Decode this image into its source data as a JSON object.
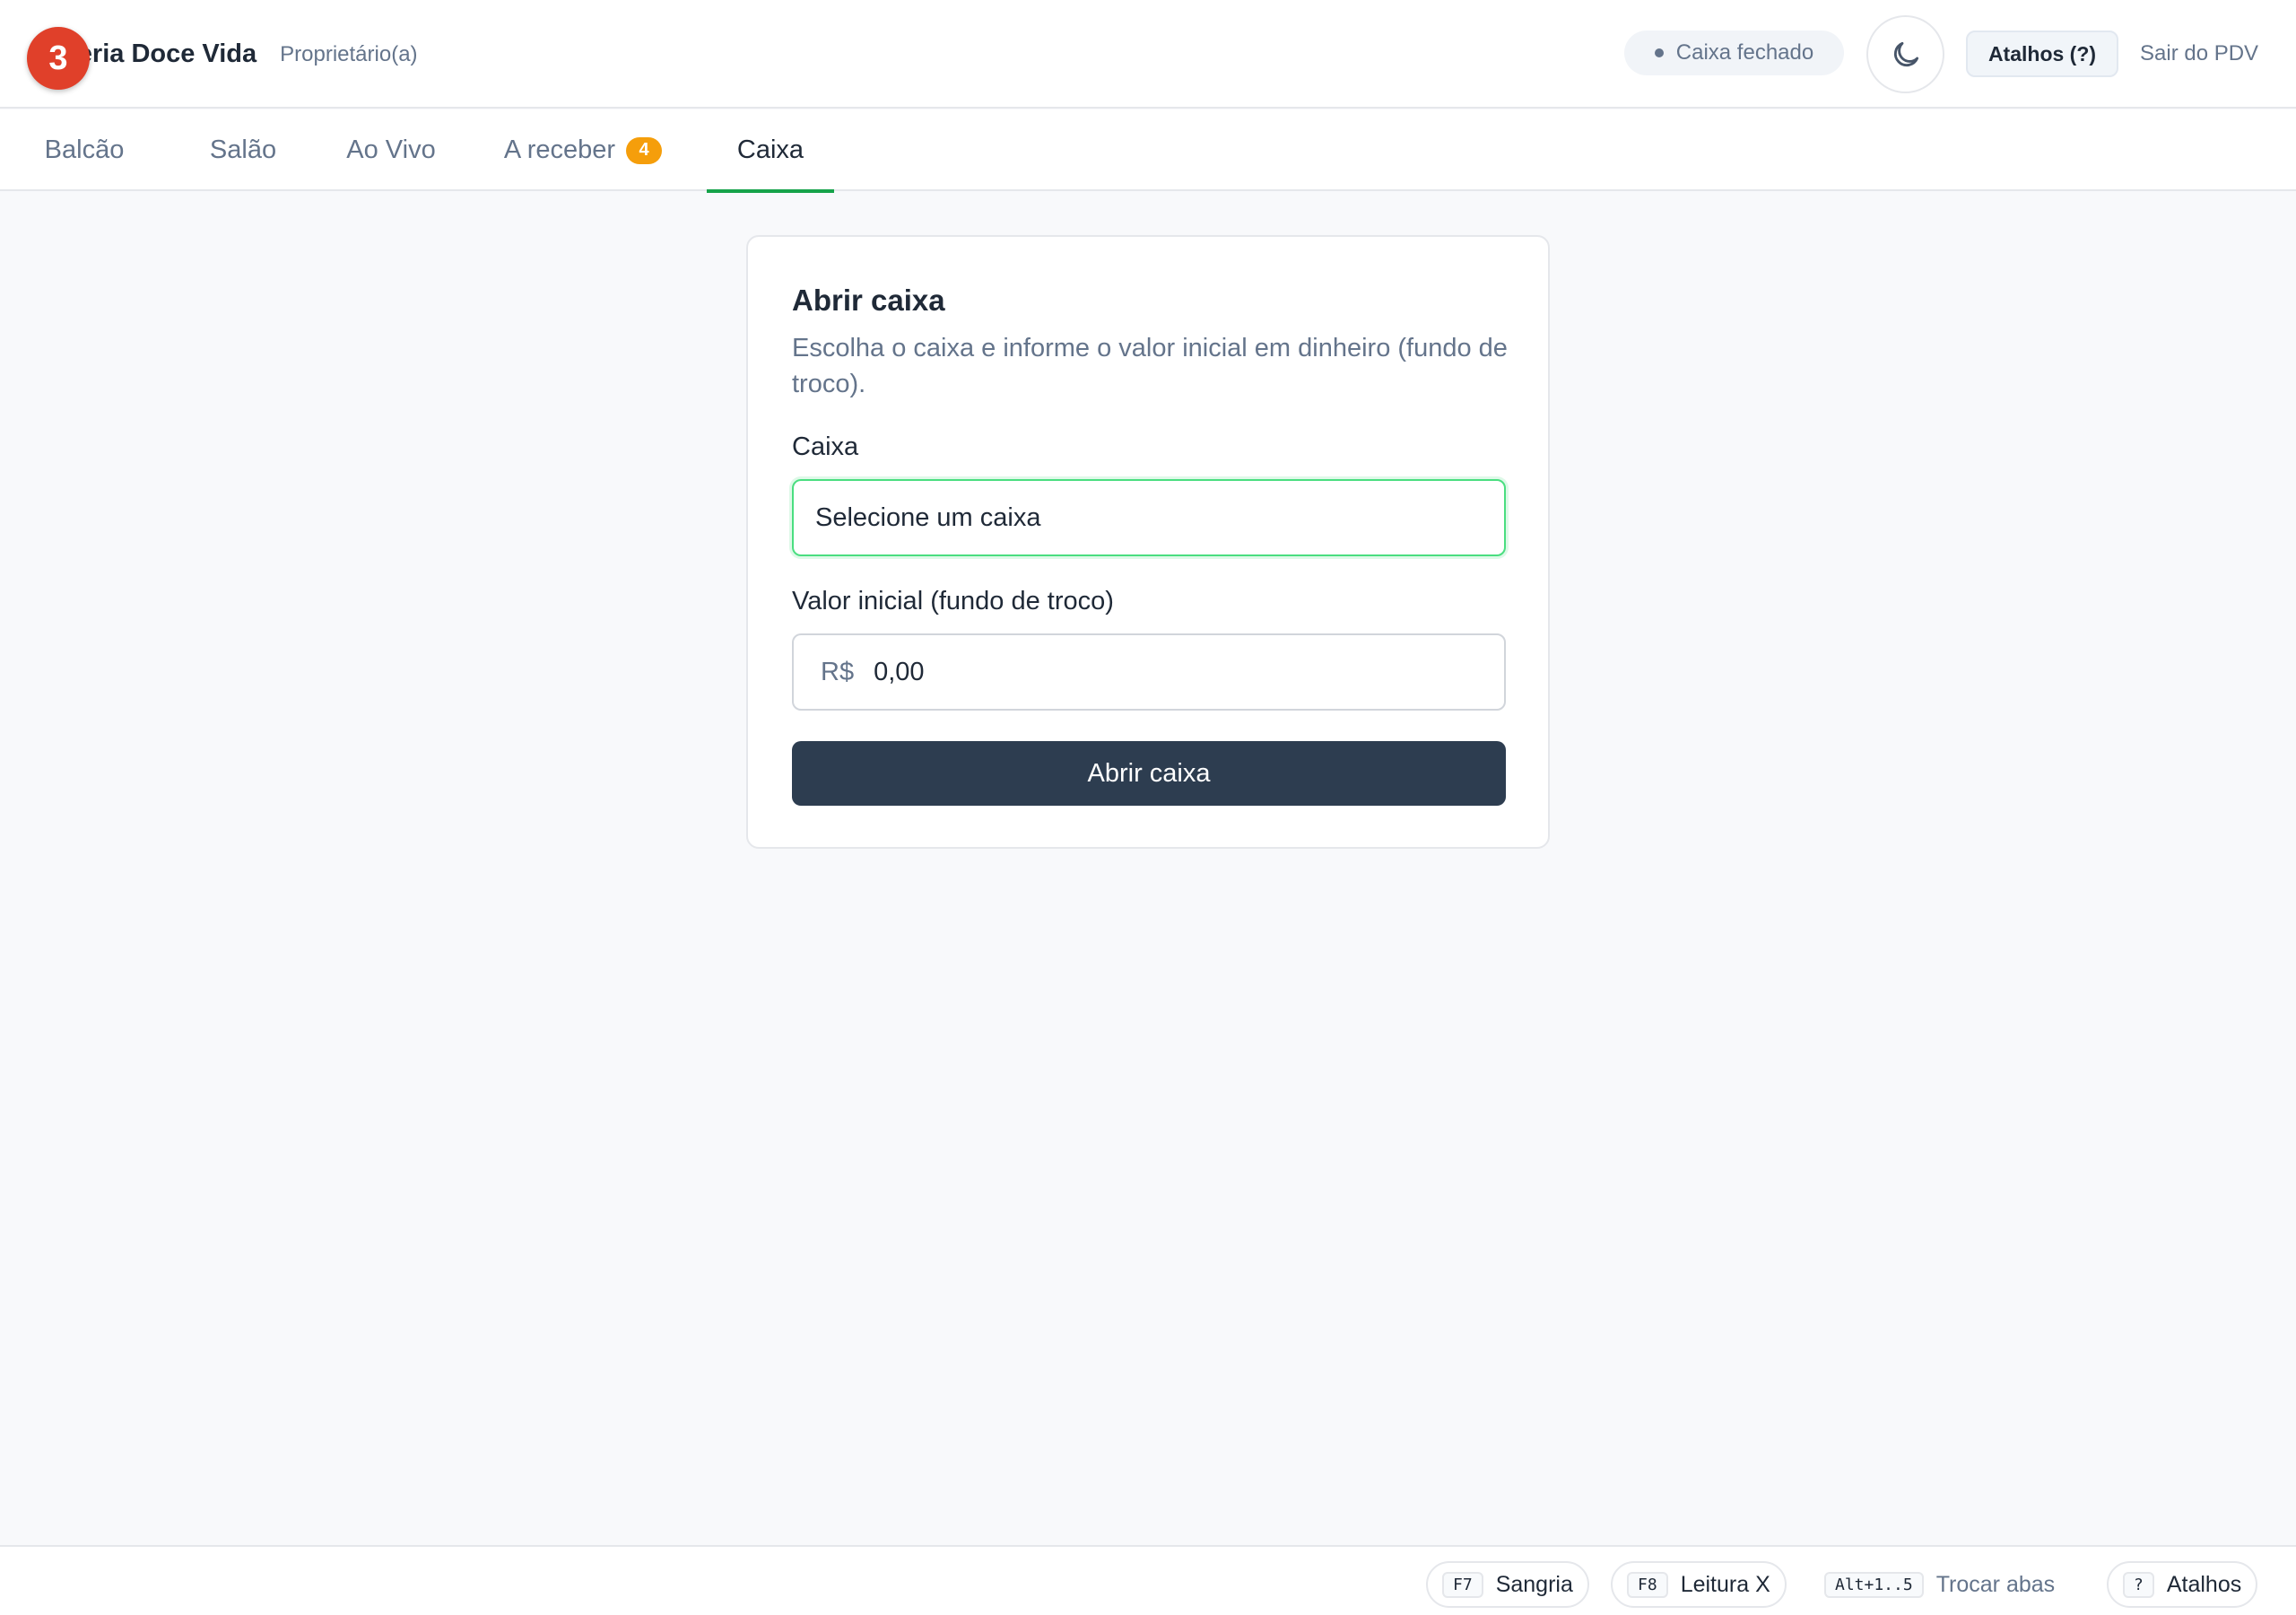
{
  "header": {
    "brand_name": "Doceria Doce Vida",
    "role": "Proprietário(a)",
    "notification_count": "3",
    "status_label": "Caixa fechado",
    "theme_icon": "moon-icon",
    "shortcuts_label": "Atalhos (?)",
    "exit_label": "Sair do PDV"
  },
  "tabs": [
    {
      "label": "Balcão",
      "badge": ""
    },
    {
      "label": "Salão",
      "badge": ""
    },
    {
      "label": "Ao Vivo",
      "badge": ""
    },
    {
      "label": "A receber",
      "badge": "4"
    },
    {
      "label": "Caixa",
      "badge": ""
    }
  ],
  "active_tab": "Caixa",
  "open_register": {
    "title": "Abrir caixa",
    "description": "Escolha o caixa e informe o valor inicial em dinheiro (fundo de troco).",
    "register_label": "Caixa",
    "register_placeholder": "Selecione um caixa",
    "amount_label": "Valor inicial (fundo de troco)",
    "currency": "R$",
    "amount_value": "0,00",
    "submit_label": "Abrir caixa"
  },
  "footer": {
    "hints": [
      {
        "key": "F7",
        "label": "Sangria"
      },
      {
        "key": "F8",
        "label": "Leitura X"
      },
      {
        "key": "Alt+1..5",
        "label": "Trocar abas"
      },
      {
        "key": "?",
        "label": "Atalhos"
      }
    ]
  },
  "colors": {
    "accent_green": "#16a34a",
    "badge_orange": "#f59e0b",
    "notification_red": "#e0402a",
    "primary_button": "#2d3d50"
  }
}
